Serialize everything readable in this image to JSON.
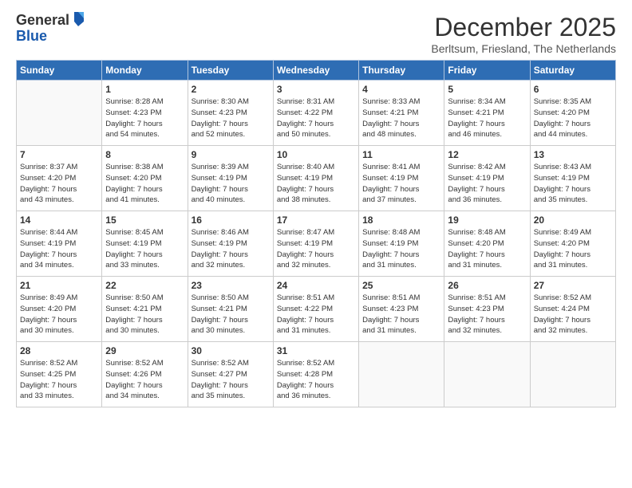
{
  "header": {
    "logo_general": "General",
    "logo_blue": "Blue",
    "month_title": "December 2025",
    "subtitle": "Berltsum, Friesland, The Netherlands"
  },
  "weekdays": [
    "Sunday",
    "Monday",
    "Tuesday",
    "Wednesday",
    "Thursday",
    "Friday",
    "Saturday"
  ],
  "weeks": [
    [
      {
        "day": "",
        "info": ""
      },
      {
        "day": "1",
        "info": "Sunrise: 8:28 AM\nSunset: 4:23 PM\nDaylight: 7 hours\nand 54 minutes."
      },
      {
        "day": "2",
        "info": "Sunrise: 8:30 AM\nSunset: 4:23 PM\nDaylight: 7 hours\nand 52 minutes."
      },
      {
        "day": "3",
        "info": "Sunrise: 8:31 AM\nSunset: 4:22 PM\nDaylight: 7 hours\nand 50 minutes."
      },
      {
        "day": "4",
        "info": "Sunrise: 8:33 AM\nSunset: 4:21 PM\nDaylight: 7 hours\nand 48 minutes."
      },
      {
        "day": "5",
        "info": "Sunrise: 8:34 AM\nSunset: 4:21 PM\nDaylight: 7 hours\nand 46 minutes."
      },
      {
        "day": "6",
        "info": "Sunrise: 8:35 AM\nSunset: 4:20 PM\nDaylight: 7 hours\nand 44 minutes."
      }
    ],
    [
      {
        "day": "7",
        "info": "Sunrise: 8:37 AM\nSunset: 4:20 PM\nDaylight: 7 hours\nand 43 minutes."
      },
      {
        "day": "8",
        "info": "Sunrise: 8:38 AM\nSunset: 4:20 PM\nDaylight: 7 hours\nand 41 minutes."
      },
      {
        "day": "9",
        "info": "Sunrise: 8:39 AM\nSunset: 4:19 PM\nDaylight: 7 hours\nand 40 minutes."
      },
      {
        "day": "10",
        "info": "Sunrise: 8:40 AM\nSunset: 4:19 PM\nDaylight: 7 hours\nand 38 minutes."
      },
      {
        "day": "11",
        "info": "Sunrise: 8:41 AM\nSunset: 4:19 PM\nDaylight: 7 hours\nand 37 minutes."
      },
      {
        "day": "12",
        "info": "Sunrise: 8:42 AM\nSunset: 4:19 PM\nDaylight: 7 hours\nand 36 minutes."
      },
      {
        "day": "13",
        "info": "Sunrise: 8:43 AM\nSunset: 4:19 PM\nDaylight: 7 hours\nand 35 minutes."
      }
    ],
    [
      {
        "day": "14",
        "info": "Sunrise: 8:44 AM\nSunset: 4:19 PM\nDaylight: 7 hours\nand 34 minutes."
      },
      {
        "day": "15",
        "info": "Sunrise: 8:45 AM\nSunset: 4:19 PM\nDaylight: 7 hours\nand 33 minutes."
      },
      {
        "day": "16",
        "info": "Sunrise: 8:46 AM\nSunset: 4:19 PM\nDaylight: 7 hours\nand 32 minutes."
      },
      {
        "day": "17",
        "info": "Sunrise: 8:47 AM\nSunset: 4:19 PM\nDaylight: 7 hours\nand 32 minutes."
      },
      {
        "day": "18",
        "info": "Sunrise: 8:48 AM\nSunset: 4:19 PM\nDaylight: 7 hours\nand 31 minutes."
      },
      {
        "day": "19",
        "info": "Sunrise: 8:48 AM\nSunset: 4:20 PM\nDaylight: 7 hours\nand 31 minutes."
      },
      {
        "day": "20",
        "info": "Sunrise: 8:49 AM\nSunset: 4:20 PM\nDaylight: 7 hours\nand 31 minutes."
      }
    ],
    [
      {
        "day": "21",
        "info": "Sunrise: 8:49 AM\nSunset: 4:20 PM\nDaylight: 7 hours\nand 30 minutes."
      },
      {
        "day": "22",
        "info": "Sunrise: 8:50 AM\nSunset: 4:21 PM\nDaylight: 7 hours\nand 30 minutes."
      },
      {
        "day": "23",
        "info": "Sunrise: 8:50 AM\nSunset: 4:21 PM\nDaylight: 7 hours\nand 30 minutes."
      },
      {
        "day": "24",
        "info": "Sunrise: 8:51 AM\nSunset: 4:22 PM\nDaylight: 7 hours\nand 31 minutes."
      },
      {
        "day": "25",
        "info": "Sunrise: 8:51 AM\nSunset: 4:23 PM\nDaylight: 7 hours\nand 31 minutes."
      },
      {
        "day": "26",
        "info": "Sunrise: 8:51 AM\nSunset: 4:23 PM\nDaylight: 7 hours\nand 32 minutes."
      },
      {
        "day": "27",
        "info": "Sunrise: 8:52 AM\nSunset: 4:24 PM\nDaylight: 7 hours\nand 32 minutes."
      }
    ],
    [
      {
        "day": "28",
        "info": "Sunrise: 8:52 AM\nSunset: 4:25 PM\nDaylight: 7 hours\nand 33 minutes."
      },
      {
        "day": "29",
        "info": "Sunrise: 8:52 AM\nSunset: 4:26 PM\nDaylight: 7 hours\nand 34 minutes."
      },
      {
        "day": "30",
        "info": "Sunrise: 8:52 AM\nSunset: 4:27 PM\nDaylight: 7 hours\nand 35 minutes."
      },
      {
        "day": "31",
        "info": "Sunrise: 8:52 AM\nSunset: 4:28 PM\nDaylight: 7 hours\nand 36 minutes."
      },
      {
        "day": "",
        "info": ""
      },
      {
        "day": "",
        "info": ""
      },
      {
        "day": "",
        "info": ""
      }
    ]
  ]
}
